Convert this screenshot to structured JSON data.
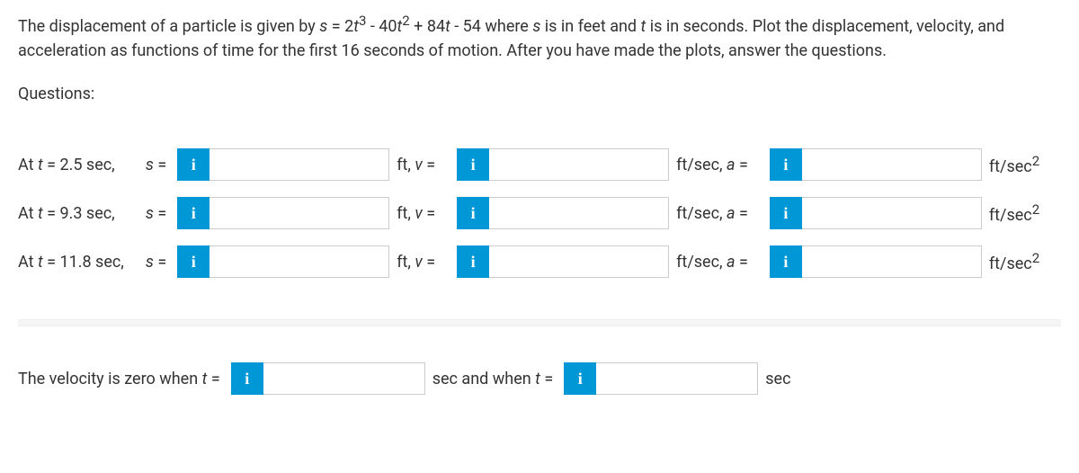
{
  "problem": {
    "text_html": "The displacement of a particle is given by <span class='var'>s</span> = 2<span class='var'>t</span><sup>3</sup> - 40<span class='var'>t</span><sup>2</sup> + 84<span class='var'>t</span> - 54 where <span class='var'>s</span> is in feet and <span class='var'>t</span> is in seconds. Plot the displacement, velocity, and acceleration as functions of time for the first 16 seconds of motion. After you have made the plots, answer the questions."
  },
  "questions_heading": "Questions:",
  "rows": [
    {
      "label_html": "At <span class='it'>t</span> = 2.5 sec,",
      "s_label_html": "<span class='it'>s</span> =",
      "s_value": "",
      "s_unit_html": "ft, <span class='it'>v</span> =",
      "v_value": "",
      "v_unit_html": "ft/sec, <span class='it'>a</span> =",
      "a_value": "",
      "a_unit_html": "ft/sec<sup>2</sup>"
    },
    {
      "label_html": "At <span class='it'>t</span> = 9.3 sec,",
      "s_label_html": "<span class='it'>s</span> =",
      "s_value": "",
      "s_unit_html": "ft, <span class='it'>v</span> =",
      "v_value": "",
      "v_unit_html": "ft/sec, <span class='it'>a</span> =",
      "a_value": "",
      "a_unit_html": "ft/sec<sup>2</sup>"
    },
    {
      "label_html": "At <span class='it'>t</span> = 11.8 sec,",
      "s_label_html": "<span class='it'>s</span> =",
      "s_value": "",
      "s_unit_html": "ft, <span class='it'>v</span> =",
      "v_value": "",
      "v_unit_html": "ft/sec, <span class='it'>a</span> =",
      "a_value": "",
      "a_unit_html": "ft/sec<sup>2</sup>"
    }
  ],
  "velocity_zero": {
    "label_html": "The velocity is zero when <span class='it'>t</span> =",
    "t1_value": "",
    "mid_label_html": "sec and when <span class='it'>t</span> =",
    "t2_value": "",
    "end_label": "sec"
  },
  "info_icon_glyph": "i"
}
